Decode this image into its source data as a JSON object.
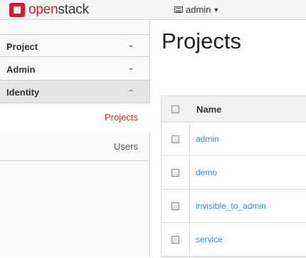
{
  "topbar": {
    "logo_text_1": "open",
    "logo_text_2": "stack",
    "user_label": "admin"
  },
  "sidebar": {
    "items": [
      {
        "label": "Project"
      },
      {
        "label": "Admin"
      },
      {
        "label": "Identity"
      }
    ],
    "sub_items": [
      {
        "label": "Projects"
      },
      {
        "label": "Users"
      }
    ]
  },
  "main": {
    "title": "Projects",
    "table": {
      "header_name": "Name",
      "rows": [
        {
          "name": "admin"
        },
        {
          "name": "demo"
        },
        {
          "name": "invisible_to_admin"
        },
        {
          "name": "service"
        }
      ]
    }
  },
  "colors": {
    "brand": "#da1a32",
    "link": "#428bca",
    "active_sub": "#c9302c"
  }
}
